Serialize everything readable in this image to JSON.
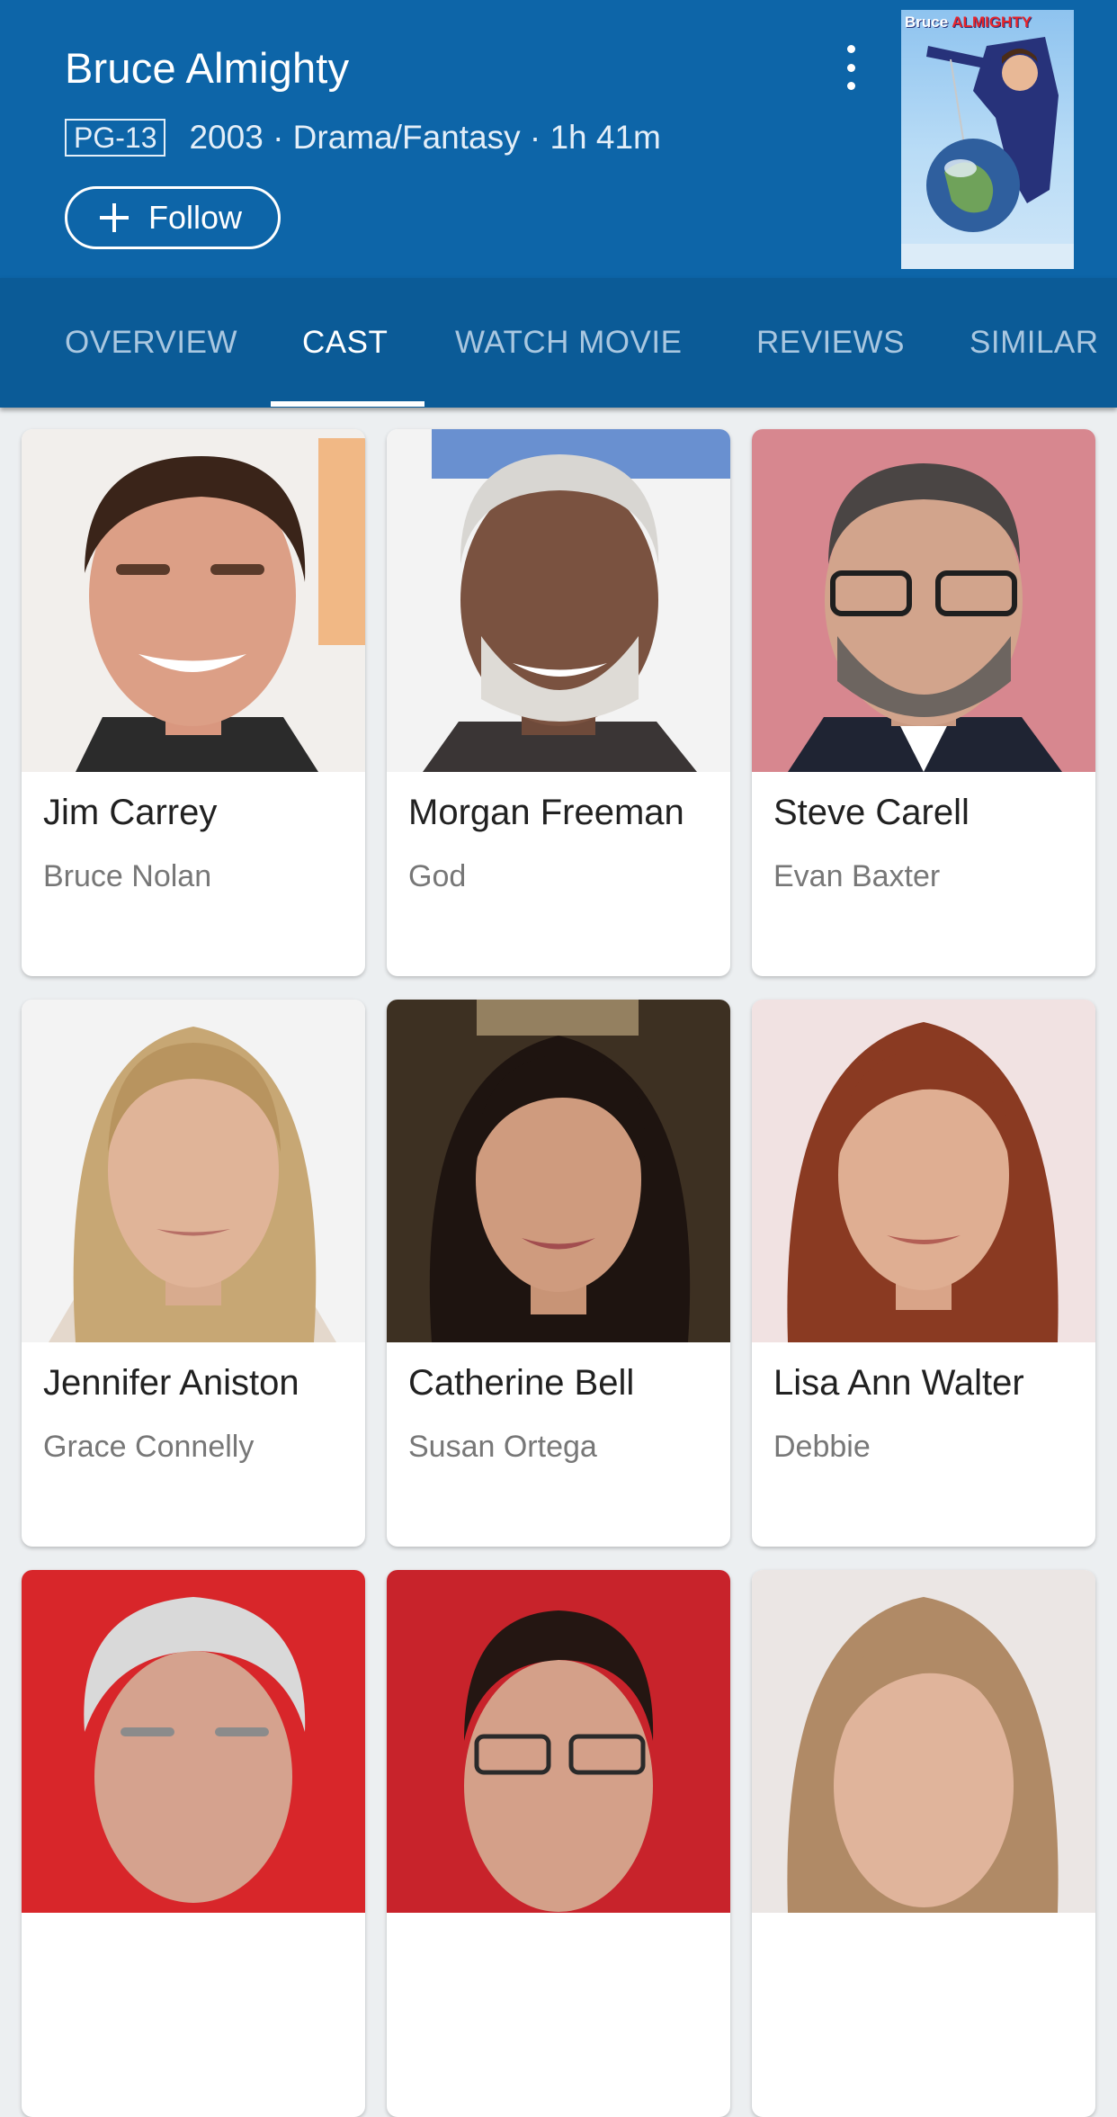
{
  "movie": {
    "title": "Bruce Almighty",
    "rating": "PG-13",
    "meta": "2003 · Drama/Fantasy · 1h 41m",
    "follow_label": "Follow",
    "poster_title_a": "Bruce",
    "poster_title_b": "ALMIGHTY"
  },
  "tabs": [
    {
      "label": "OVERVIEW"
    },
    {
      "label": "CAST"
    },
    {
      "label": "WATCH MOVIE"
    },
    {
      "label": "REVIEWS"
    },
    {
      "label": "SIMILAR"
    }
  ],
  "active_tab": "CAST",
  "cast": [
    {
      "name": "Jim Carrey",
      "role": "Bruce Nolan"
    },
    {
      "name": "Morgan Freeman",
      "role": "God"
    },
    {
      "name": "Steve Carell",
      "role": "Evan Baxter"
    },
    {
      "name": "Jennifer Aniston",
      "role": "Grace Connelly"
    },
    {
      "name": "Catherine Bell",
      "role": "Susan Ortega"
    },
    {
      "name": "Lisa Ann Walter",
      "role": "Debbie"
    },
    {
      "name": "",
      "role": ""
    },
    {
      "name": "",
      "role": ""
    },
    {
      "name": "",
      "role": ""
    }
  ],
  "colors": {
    "header_bg": "#0d65a8",
    "tabs_bg": "#0b5b97",
    "active_tab": "#ffffff",
    "inactive_tab": "#a9c7e0"
  }
}
